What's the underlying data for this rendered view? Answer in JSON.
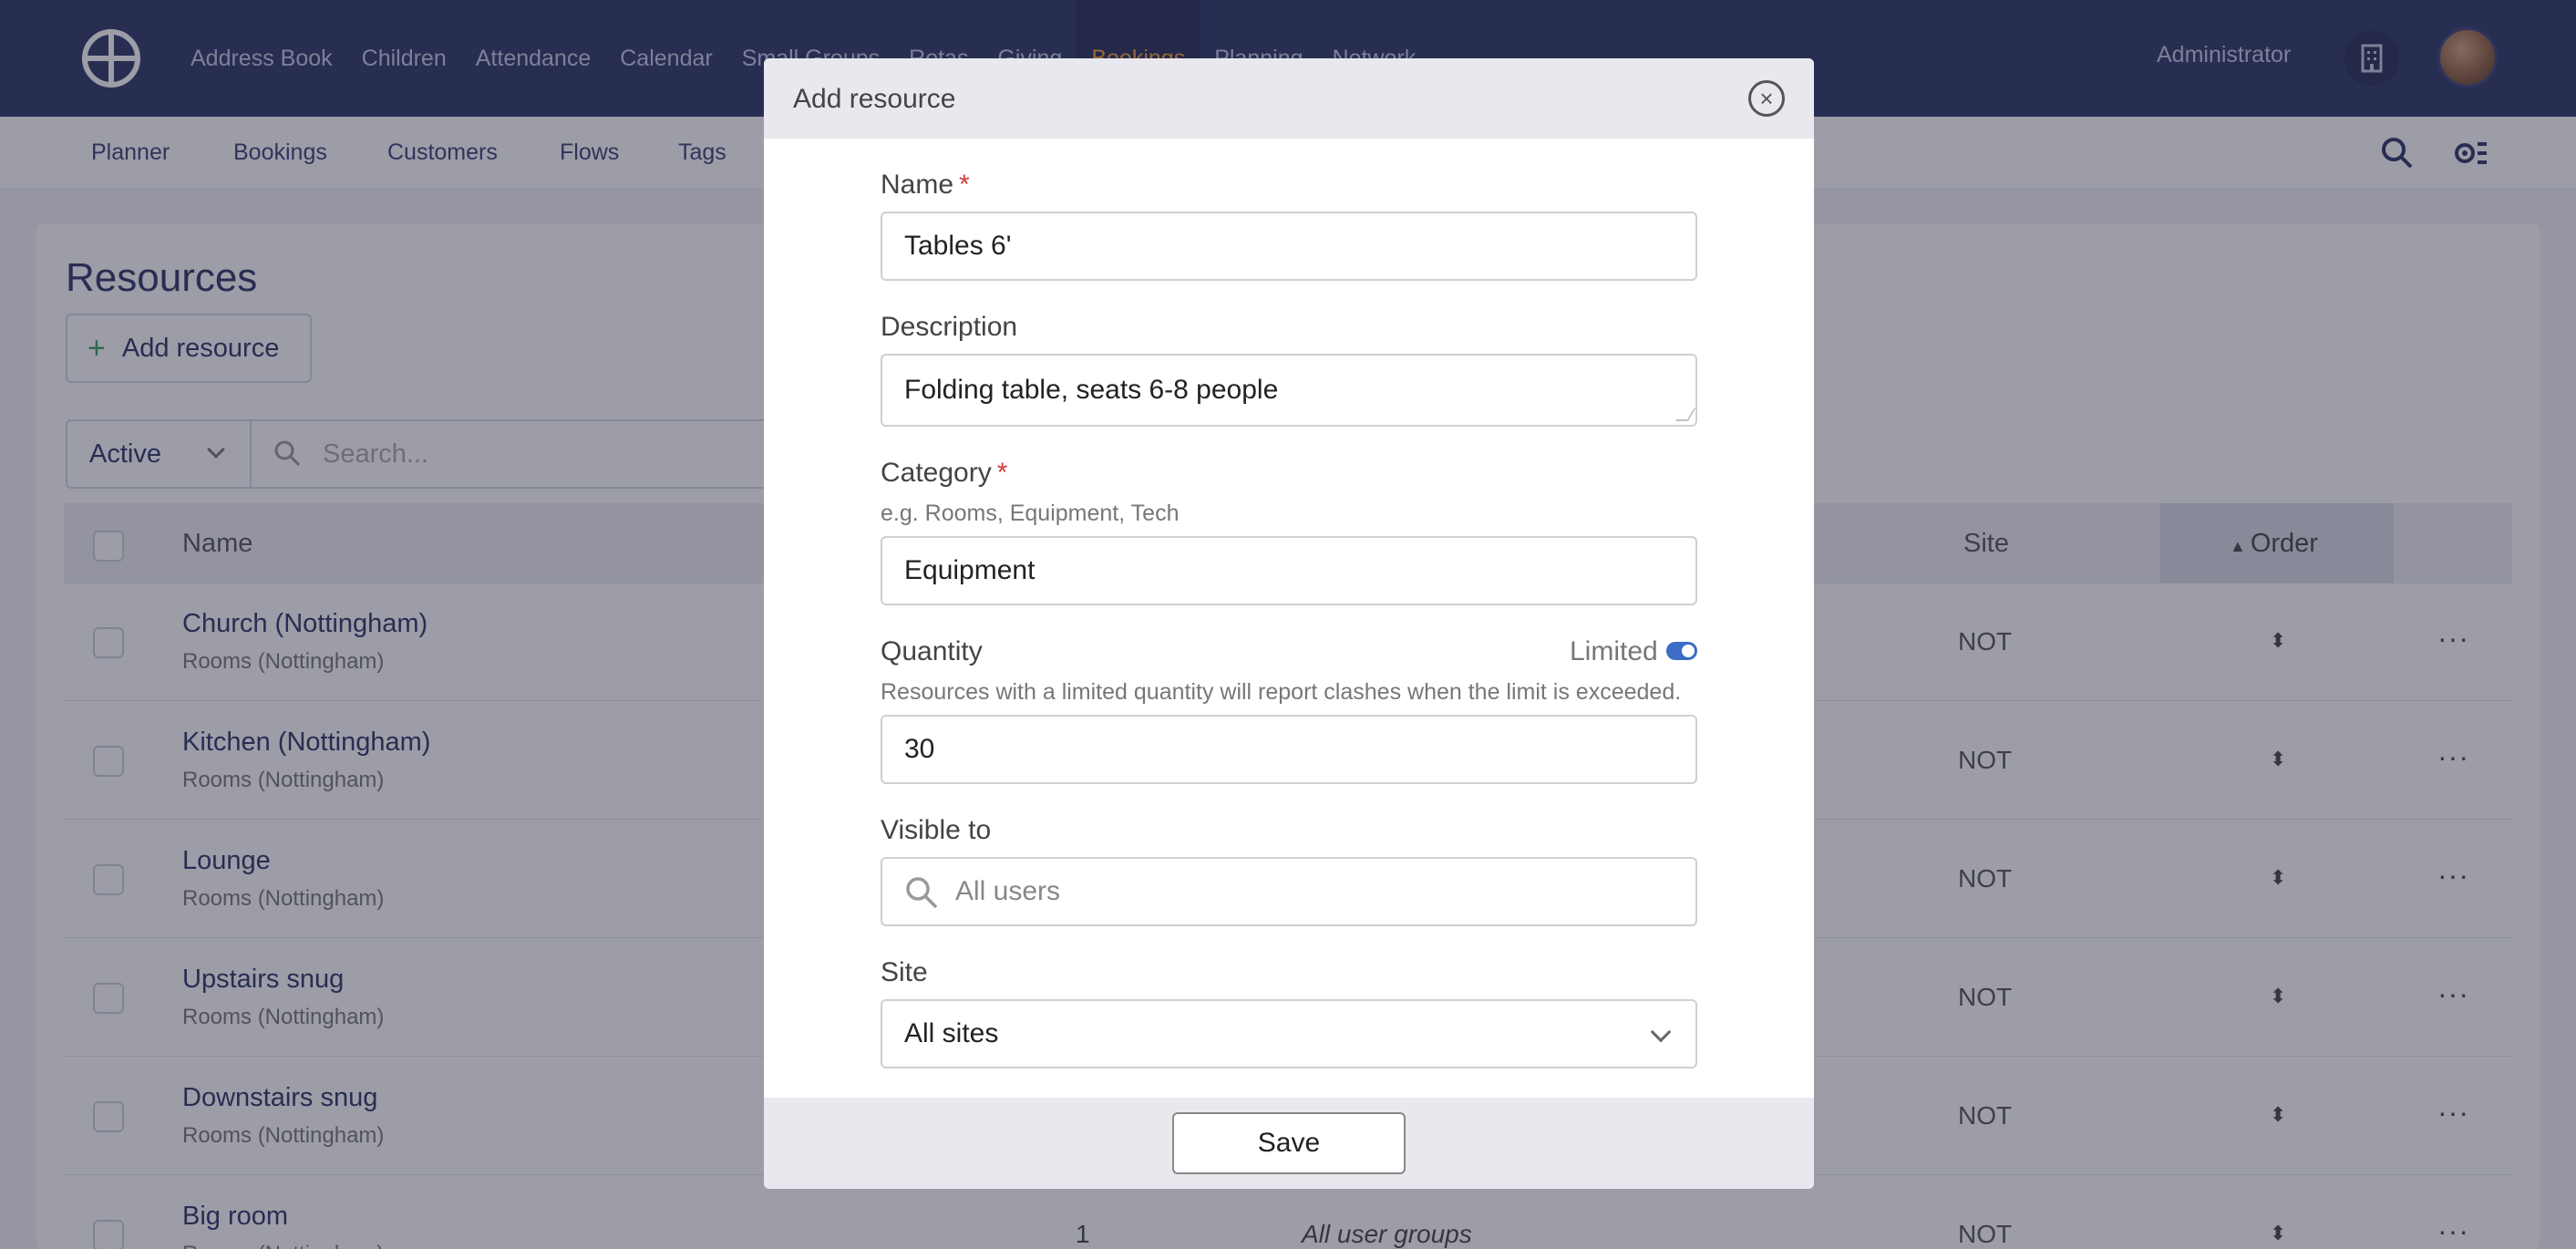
{
  "topnav": {
    "items": [
      "Address Book",
      "Children",
      "Attendance",
      "Calendar",
      "Small Groups",
      "Rotas",
      "Giving",
      "Bookings",
      "Planning",
      "Network"
    ],
    "active_index": 7,
    "user_label": "Administrator",
    "logo_icon": "church-logo-icon",
    "building_icon": "building-icon"
  },
  "subnav": {
    "items": [
      "Planner",
      "Bookings",
      "Customers",
      "Flows",
      "Tags"
    ]
  },
  "page": {
    "title": "Resources",
    "add_button": "Add resource",
    "filter_value": "Active",
    "search_placeholder": "Search..."
  },
  "table": {
    "columns": {
      "name": "Name",
      "site": "Site",
      "order": "Order"
    },
    "rows": [
      {
        "name": "Church (Nottingham)",
        "category": "Rooms (Nottingham)",
        "site": "NOT"
      },
      {
        "name": "Kitchen (Nottingham)",
        "category": "Rooms (Nottingham)",
        "site": "NOT"
      },
      {
        "name": "Lounge",
        "category": "Rooms (Nottingham)",
        "site": "NOT"
      },
      {
        "name": "Upstairs snug",
        "category": "Rooms (Nottingham)",
        "site": "NOT"
      },
      {
        "name": "Downstairs snug",
        "category": "Rooms (Nottingham)",
        "site": "NOT"
      },
      {
        "name": "Big room",
        "category": "Rooms (Nottingham)",
        "site": "NOT",
        "quantity": "1",
        "groups": "All user groups"
      }
    ],
    "more_label": "···",
    "order_glyph": "⬍"
  },
  "modal": {
    "title": "Add resource",
    "close_icon": "close-circle-icon",
    "name_label": "Name",
    "required_mark": "*",
    "name_value": "Tables 6'",
    "description_label": "Description",
    "description_value": "Folding table, seats 6-8 people",
    "category_label": "Category",
    "category_hint": "e.g. Rooms, Equipment, Tech",
    "category_value": "Equipment",
    "quantity_label": "Quantity",
    "limited_label": "Limited",
    "limited_on": true,
    "quantity_hint": "Resources with a limited quantity will report clashes when the limit is exceeded.",
    "quantity_value": "30",
    "visible_label": "Visible to",
    "visible_placeholder": "All users",
    "site_label": "Site",
    "site_value": "All sites",
    "save_label": "Save"
  },
  "colors": {
    "nav_bg": "#2d3364",
    "accent": "#f0a23a",
    "required": "#d23b3b",
    "toggle_on": "#3b6cc6"
  }
}
